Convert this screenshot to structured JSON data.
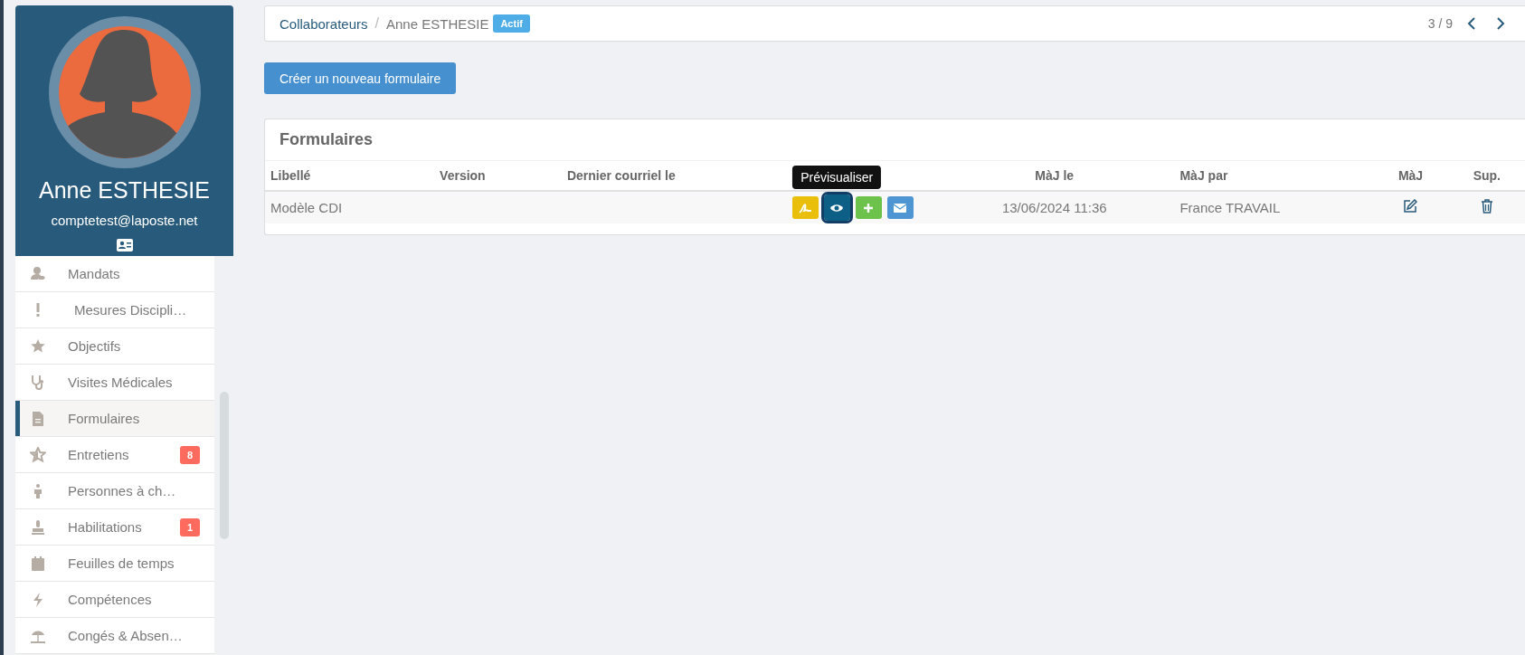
{
  "profile": {
    "name": "Anne ESTHESIE",
    "email": "comptetest@laposte.net"
  },
  "sidebar": {
    "items": [
      {
        "label": "Mandats",
        "selected": false
      },
      {
        "label": "Mesures Discipli…",
        "selected": false
      },
      {
        "label": "Objectifs",
        "selected": false
      },
      {
        "label": "Visites Médicales",
        "selected": false
      },
      {
        "label": "Formulaires",
        "selected": true
      },
      {
        "label": "Entretiens",
        "selected": false,
        "badge": "8"
      },
      {
        "label": "Personnes à ch…",
        "selected": false
      },
      {
        "label": "Habilitations",
        "selected": false,
        "badge": "1"
      },
      {
        "label": "Feuilles de temps",
        "selected": false
      },
      {
        "label": "Compétences",
        "selected": false
      },
      {
        "label": "Congés & Absen…",
        "selected": false
      }
    ]
  },
  "breadcrumb": {
    "items": [
      "Collaborateurs",
      "Anne ESTHESIE"
    ],
    "separator": "/",
    "status": "Actif",
    "pager": "3 / 9"
  },
  "create_button": "Créer un nouveau formulaire",
  "panel": {
    "title": "Formulaires",
    "table": {
      "columns": [
        "Libellé",
        "Version",
        "Dernier courriel le",
        "MàJ le",
        "MàJ par",
        "MàJ",
        "Sup."
      ],
      "rows": [
        {
          "label": "Modèle CDI",
          "updated": "13/06/2024 11:36",
          "updated_by": "France TRAVAIL",
          "actions": [
            {
              "kind": "sign",
              "focused": false
            },
            {
              "kind": "preview",
              "focused": true,
              "tooltip": "Prévisualiser"
            },
            {
              "kind": "add",
              "focused": false
            },
            {
              "kind": "mail",
              "focused": false
            }
          ]
        }
      ]
    }
  }
}
